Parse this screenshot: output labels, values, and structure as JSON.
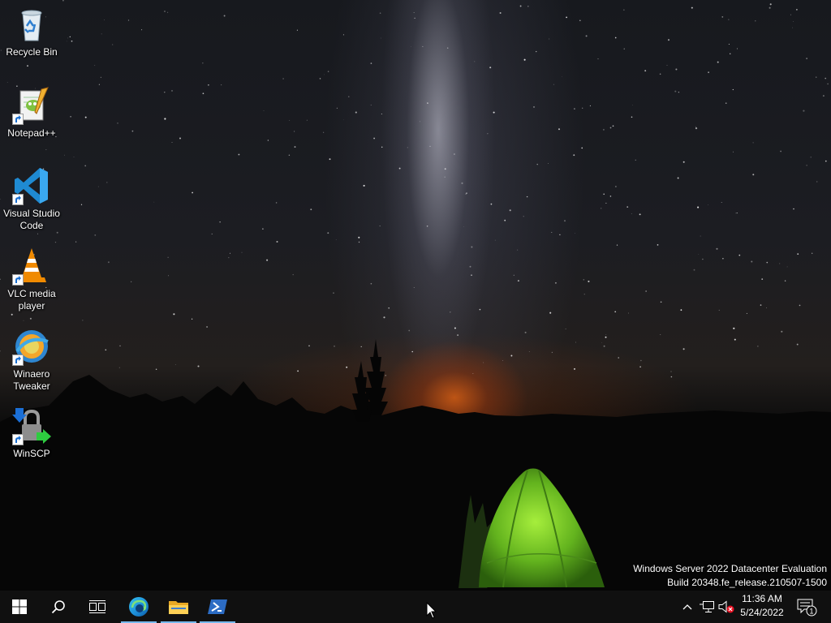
{
  "desktop": {
    "wallpaper": "night-sky-milky-way-tent",
    "icons": [
      {
        "label": "Recycle Bin",
        "icon": "recycle-bin-icon"
      },
      {
        "label": "Notepad++",
        "icon": "notepad-plus-plus-icon"
      },
      {
        "label": "Visual Studio Code",
        "icon": "vscode-icon"
      },
      {
        "label": "VLC media player",
        "icon": "vlc-icon"
      },
      {
        "label": "Winaero Tweaker",
        "icon": "winaero-tweaker-icon"
      },
      {
        "label": "WinSCP",
        "icon": "winscp-icon"
      }
    ],
    "watermark": {
      "line1": "Windows Server 2022 Datacenter Evaluation",
      "line2": "Build 20348.fe_release.210507-1500"
    }
  },
  "taskbar": {
    "buttons": [
      {
        "icon": "windows-start-icon"
      },
      {
        "icon": "search-icon"
      },
      {
        "icon": "task-view-icon"
      },
      {
        "icon": "edge-icon",
        "running": true
      },
      {
        "icon": "file-explorer-icon",
        "running": true
      },
      {
        "icon": "powershell-icon",
        "running": true
      }
    ],
    "tray": {
      "icons": [
        "chevron-up-icon",
        "network-icon",
        "volume-muted-icon"
      ],
      "time": "11:36 AM",
      "date": "5/24/2022",
      "notification_count": "1"
    },
    "accent": "#76b9ed",
    "background": "#101010"
  }
}
